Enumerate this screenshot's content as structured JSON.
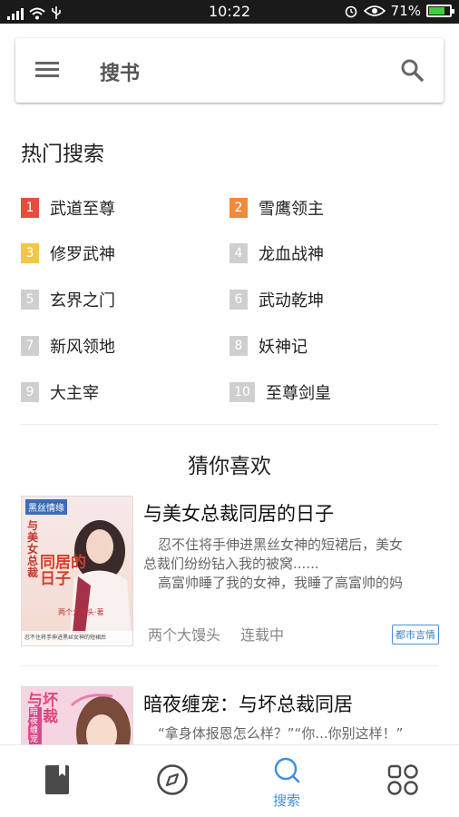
{
  "status_bar": {
    "time": "10:22",
    "battery": "71%"
  },
  "search": {
    "placeholder": "搜书"
  },
  "hot": {
    "title": "热门搜索",
    "items": [
      {
        "rank": "1",
        "name": "武道至尊",
        "color": "#e84c3d"
      },
      {
        "rank": "2",
        "name": "雪鹰领主",
        "color": "#f08a3e"
      },
      {
        "rank": "3",
        "name": "修罗武神",
        "color": "#f2c744"
      },
      {
        "rank": "4",
        "name": "龙血战神",
        "color": "#cfcfcf"
      },
      {
        "rank": "5",
        "name": "玄界之门",
        "color": "#cfcfcf"
      },
      {
        "rank": "6",
        "name": "武动乾坤",
        "color": "#cfcfcf"
      },
      {
        "rank": "7",
        "name": "新风领地",
        "color": "#cfcfcf"
      },
      {
        "rank": "8",
        "name": "妖神记",
        "color": "#cfcfcf"
      },
      {
        "rank": "9",
        "name": "大主宰",
        "color": "#cfcfcf"
      },
      {
        "rank": "10",
        "name": "至尊剑皇",
        "color": "#cfcfcf"
      }
    ]
  },
  "guess": {
    "title": "猜你喜欢",
    "books": [
      {
        "title": "与美女总裁同居的日子",
        "desc1": "忍不住将手伸进黑丝女神的短裙后，美女",
        "desc2": "总裁们纷纷钻入我的被窝......",
        "desc3": "高富帅睡了我的女神，我睡了高富帅的妈",
        "author": "两个大馒头",
        "status": "连载中",
        "tag": "都市言情",
        "cover": {
          "banner": "黑丝情缘",
          "side": "与美女总裁",
          "big": "同居的日子",
          "small": "两个大馒头·著",
          "foot": "忍不住将手伸进黑丝女神的短裙后"
        }
      },
      {
        "title": "暗夜缠宠：与坏总裁同居",
        "desc1": "“拿身体报恩怎么样？”“你...你别这样！”",
        "cover": {
          "side": "与坏总裁同",
          "badge": "暗夜缠宠"
        }
      }
    ]
  },
  "nav": {
    "items": [
      {
        "icon": "bookshelf-icon"
      },
      {
        "icon": "compass-icon"
      },
      {
        "icon": "search-icon",
        "label": "搜索"
      },
      {
        "icon": "apps-grid-icon"
      }
    ],
    "active_color": "#3d8fe0"
  }
}
